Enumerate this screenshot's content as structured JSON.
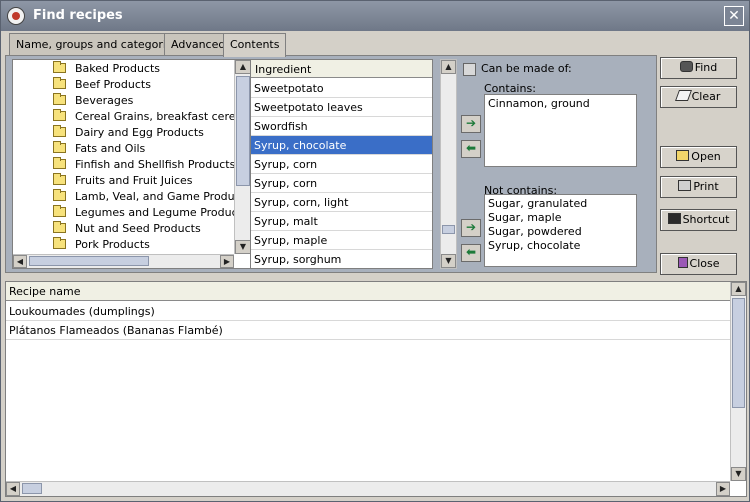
{
  "window": {
    "title": "Find recipes",
    "close_glyph": "✕"
  },
  "tabs": [
    {
      "label": "Name, groups and categories"
    },
    {
      "label": "Advanced"
    },
    {
      "label": "Contents"
    }
  ],
  "tree": {
    "items": [
      "Baked Products",
      "Beef Products",
      "Beverages",
      "Cereal Grains, breakfast cereals",
      "Dairy and Egg Products",
      "Fats and Oils",
      "Finfish and Shellfish Products",
      "Fruits and Fruit Juices",
      "Lamb, Veal, and Game Products",
      "Legumes and Legume Products",
      "Nut and Seed Products",
      "Pork Products"
    ]
  },
  "ingredients": {
    "header": "Ingredient",
    "rows": [
      "Sweetpotato",
      "Sweetpotato leaves",
      "Swordfish",
      "Syrup, chocolate",
      "Syrup, corn",
      "Syrup, corn",
      "Syrup, corn, light",
      "Syrup, malt",
      "Syrup, maple",
      "Syrup, sorghum"
    ],
    "selected_index": 3
  },
  "filters": {
    "can_be_made_of_label": "Can be made of:",
    "contains_label": "Contains:",
    "contains_items": [
      "Cinnamon, ground"
    ],
    "not_contains_label": "Not contains:",
    "not_contains_items": [
      "Sugar, granulated",
      "Sugar, maple",
      "Sugar, powdered",
      "Syrup, chocolate"
    ]
  },
  "buttons": {
    "find": "Find",
    "clear": "Clear",
    "open": "Open",
    "print": "Print",
    "shortcut": "Shortcut",
    "close": "Close"
  },
  "arrows": {
    "add": "➔",
    "remove": "⬅"
  },
  "results": {
    "header": "Recipe name",
    "rows": [
      "Loukoumades (dumplings)",
      "Plátanos Flameados (Bananas Flambé)"
    ]
  },
  "colors": {
    "selected_row": "#3a6ec7",
    "titlebar": "#7c8595"
  },
  "icons": {
    "find": "binoculars-icon",
    "clear": "eraser-icon",
    "open": "folder-open-icon",
    "print": "printer-icon",
    "shortcut": "floppy-disk-icon",
    "close": "door-exit-icon"
  }
}
